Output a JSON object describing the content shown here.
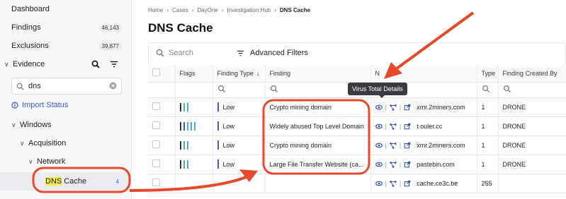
{
  "sidebar": {
    "items": [
      {
        "label": "Dashboard",
        "count": ""
      },
      {
        "label": "Findings",
        "count": "46,143"
      },
      {
        "label": "Exclusions",
        "count": "39,877"
      },
      {
        "label": "Evidence",
        "count": ""
      },
      {
        "label": "Import Status",
        "count": ""
      },
      {
        "label": "Windows",
        "count": ""
      },
      {
        "label": "Acquisition",
        "count": ""
      },
      {
        "label": "Network",
        "count": ""
      }
    ],
    "search_value": "dns",
    "active_item": {
      "label_highlight": "DNS",
      "label_rest": " Cache",
      "count": "4"
    }
  },
  "breadcrumb": [
    "Home",
    "Cases",
    "DayOne",
    "Investigation Hub",
    "DNS Cache"
  ],
  "page_title": "DNS Cache",
  "toolbar": {
    "search_placeholder": "Search",
    "filter_label": "Advanced Filters"
  },
  "table": {
    "columns": [
      "Flags",
      "Finding Type",
      "Finding",
      "Name",
      "Type",
      "Finding Created By"
    ],
    "name_header_visible": "N",
    "rows": [
      {
        "severity": "Low",
        "finding": "Crypto mining domain",
        "name": "xmr.2miners.com",
        "type": "1",
        "created_by": "DRONE",
        "flags": [
          "#333333",
          "#4dabc7",
          "#4dabc7"
        ]
      },
      {
        "severity": "Low",
        "finding": "Widely abused Top Level Domain",
        "name": "t.ouler.cc",
        "type": "1",
        "created_by": "DRONE",
        "flags": [
          "#333333",
          "#3b5bdb",
          "#4dabc7",
          "#4dabc7",
          "#4dabc7"
        ]
      },
      {
        "severity": "Low",
        "finding": "Crypto mining domain",
        "name": "xmr.2miners.com",
        "type": "1",
        "created_by": "DRONE",
        "flags": [
          "#333333",
          "#4dabc7",
          "#4dabc7"
        ]
      },
      {
        "severity": "Low",
        "finding": "Large File Transfer Website (ca...",
        "name": "pastebin.com",
        "type": "1",
        "created_by": "DRONE",
        "flags": [
          "#333333",
          "#4dabc7",
          "#4dabc7"
        ]
      },
      {
        "severity": "",
        "finding": "",
        "name": "cache.ce3c.be",
        "type": "255",
        "created_by": "",
        "flags": []
      }
    ]
  },
  "tooltip": "Virus Total Details",
  "colors": {
    "accent": "#3b5bdb",
    "annotation": "#e8482b",
    "highlight": "#f3f04a"
  }
}
